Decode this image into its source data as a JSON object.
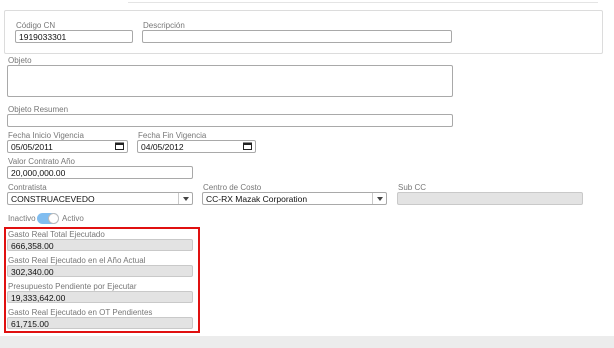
{
  "header": {
    "codigo_label": "Código CN",
    "codigo_value": "1919033301",
    "descripcion_label": "Descripción",
    "descripcion_value": ""
  },
  "objeto": {
    "label": "Objeto",
    "value": ""
  },
  "objeto_resumen": {
    "label": "Objeto Resumen",
    "value": ""
  },
  "vigencia": {
    "inicio_label": "Fecha Inicio Vigencia",
    "inicio_value": "05/05/2011",
    "fin_label": "Fecha Fin Vigencia",
    "fin_value": "04/05/2012"
  },
  "valor_contrato": {
    "label": "Valor Contrato Año",
    "value": "20,000,000.00"
  },
  "contratista": {
    "label": "Contratista",
    "value": "CONSTRUACEVEDO"
  },
  "centro_costo": {
    "label": "Centro de Costo",
    "value": "CC-RX Mazak Corporation"
  },
  "sub_cc": {
    "label": "Sub CC",
    "value": ""
  },
  "estado": {
    "inactive_label": "Inactivo",
    "active_label": "Activo",
    "is_active": true
  },
  "gastos": {
    "total_label": "Gasto Real Total Ejecutado",
    "total_value": "666,358.00",
    "anio_label": "Gasto Real Ejecutado en el Año Actual",
    "anio_value": "302,340.00",
    "pendiente_label": "Presupuesto Pendiente por Ejecutar",
    "pendiente_value": "19,333,642.00",
    "ot_label": "Gasto Real Ejecutado en OT Pendientes",
    "ot_value": "61,715.00"
  },
  "colors": {
    "highlight": "#e01010",
    "toggle_on": "#80bdf0"
  }
}
